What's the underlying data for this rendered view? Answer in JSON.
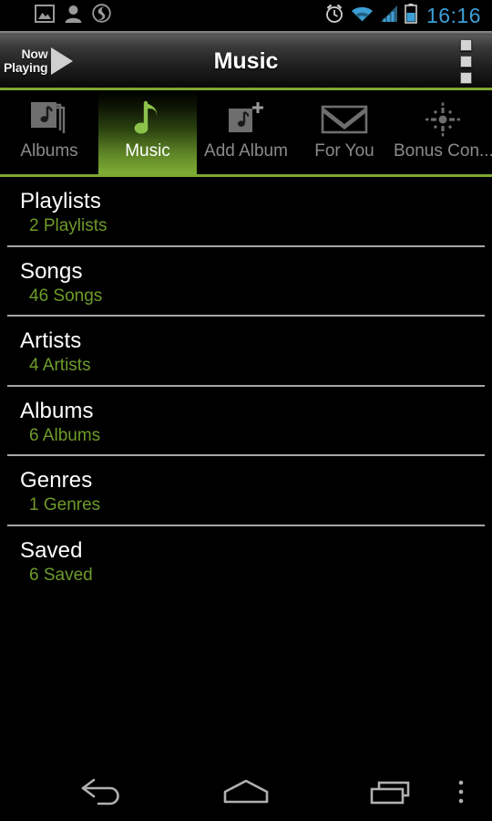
{
  "status_bar": {
    "left_icons": [
      {
        "name": "image-icon",
        "label": "Screenshot"
      },
      {
        "name": "person-icon",
        "label": "Contact"
      },
      {
        "name": "swirl-s-icon",
        "label": "SwiftKey"
      }
    ],
    "right_icons": [
      {
        "name": "alarm-clock-icon",
        "label": "Alarm set"
      },
      {
        "name": "wifi-icon",
        "label": "Wi-Fi"
      },
      {
        "name": "signal-bars-icon",
        "label": "Cellular signal"
      },
      {
        "name": "battery-icon",
        "label": "Battery"
      }
    ],
    "clock": "16:16",
    "clock_color": "#3C9FD6"
  },
  "action_bar": {
    "now_playing_line1": "Now",
    "now_playing_line2": "Playing",
    "now_playing_icon": "play-triangle-icon",
    "title": "Music",
    "overflow_icon": "overflow-squares-icon"
  },
  "tabs": [
    {
      "label": "Albums",
      "icon": "album-stack-icon",
      "selected": false
    },
    {
      "label": "Music",
      "icon": "music-note-icon",
      "selected": true
    },
    {
      "label": "Add Album",
      "icon": "add-album-icon",
      "selected": false
    },
    {
      "label": "For You",
      "icon": "envelope-icon",
      "selected": false
    },
    {
      "label": "Bonus Con...",
      "icon": "sparkle-icon",
      "selected": false
    }
  ],
  "list": [
    {
      "title": "Playlists",
      "subtitle": "2 Playlists"
    },
    {
      "title": "Songs",
      "subtitle": "46 Songs"
    },
    {
      "title": "Artists",
      "subtitle": "4 Artists"
    },
    {
      "title": "Albums",
      "subtitle": "6 Albums"
    },
    {
      "title": "Genres",
      "subtitle": "1 Genres"
    },
    {
      "title": "Saved",
      "subtitle": "6 Saved"
    }
  ],
  "nav_bar": [
    {
      "name": "back-icon",
      "label": "Back"
    },
    {
      "name": "home-icon",
      "label": "Home"
    },
    {
      "name": "recent-apps-icon",
      "label": "Recent apps"
    },
    {
      "name": "overflow-dots-icon",
      "label": "Menu"
    }
  ],
  "colors": {
    "accent_green": "#7EA832",
    "subtitle_green": "#6E9B2A",
    "clock_blue": "#3C9FD6",
    "background": "#000000",
    "divider": "#A6A6A6"
  }
}
